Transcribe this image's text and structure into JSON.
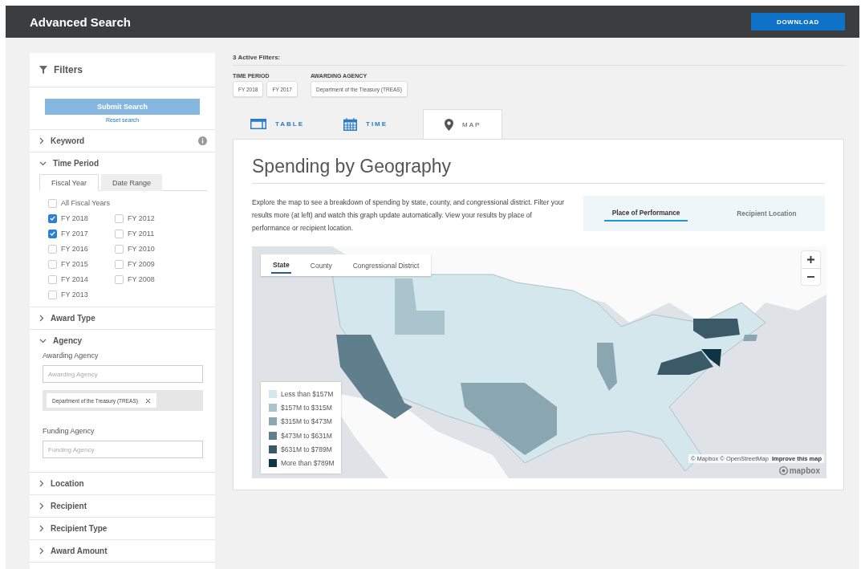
{
  "header": {
    "title": "Advanced Search",
    "download_button": "DOWNLOAD"
  },
  "sidebar": {
    "title": "Filters",
    "submit_button": "Submit Search",
    "reset_link": "Reset search",
    "sections": [
      {
        "label": "Keyword",
        "expanded": false,
        "kind": "keyword"
      },
      {
        "label": "Time Period",
        "expanded": true,
        "kind": "time",
        "tabs": [
          {
            "label": "Fiscal Year",
            "selected": true
          },
          {
            "label": "Date Range",
            "selected": false
          }
        ],
        "all_option": {
          "label": "All Fiscal Years",
          "checked": false
        },
        "years": [
          {
            "label": "FY 2018",
            "checked": true
          },
          {
            "label": "FY 2012",
            "checked": false
          },
          {
            "label": "FY 2017",
            "checked": true
          },
          {
            "label": "FY 2011",
            "checked": false
          },
          {
            "label": "FY 2016",
            "checked": false
          },
          {
            "label": "FY 2010",
            "checked": false
          },
          {
            "label": "FY 2015",
            "checked": false
          },
          {
            "label": "FY 2009",
            "checked": false
          },
          {
            "label": "FY 2014",
            "checked": false
          },
          {
            "label": "FY 2008",
            "checked": false
          },
          {
            "label": "FY 2013",
            "checked": false
          }
        ]
      },
      {
        "label": "Award Type",
        "expanded": false,
        "kind": "plain"
      },
      {
        "label": "Agency",
        "expanded": true,
        "kind": "agency",
        "fields": [
          {
            "label": "Awarding Agency",
            "placeholder": "Awarding Agency",
            "tags": [
              "Department of the Treasury (TREAS)"
            ]
          },
          {
            "label": "Funding Agency",
            "placeholder": "Funding Agency"
          }
        ]
      },
      {
        "label": "Location",
        "expanded": false,
        "kind": "plain"
      },
      {
        "label": "Recipient",
        "expanded": false,
        "kind": "plain"
      },
      {
        "label": "Recipient Type",
        "expanded": false,
        "kind": "plain"
      },
      {
        "label": "Award Amount",
        "expanded": false,
        "kind": "plain"
      }
    ]
  },
  "active_filters": {
    "title": "3 Active Filters:",
    "groups": [
      {
        "label": "TIME PERIOD",
        "chips": [
          "FY 2018",
          "FY 2017"
        ]
      },
      {
        "label": "AWARDING AGENCY",
        "chips": [
          "Department of the Treasury (TREAS)"
        ]
      }
    ]
  },
  "view_tabs": [
    {
      "label": "TABLE",
      "selected": false,
      "kind": "table"
    },
    {
      "label": "TIME",
      "selected": false,
      "kind": "time"
    },
    {
      "label": "MAP",
      "selected": true,
      "kind": "map"
    }
  ],
  "panel": {
    "title": "Spending by Geography",
    "description": "Explore the map to see a breakdown of spending by state, county, and congressional district. Filter your results more (at left) and watch this graph update automatically. View your results by place of performance or recipient location.",
    "location_toggle": [
      {
        "label": "Place of Performance",
        "selected": true
      },
      {
        "label": "Recipient Location",
        "selected": false
      }
    ],
    "map": {
      "scope_tabs": [
        {
          "label": "State",
          "selected": true
        },
        {
          "label": "County",
          "selected": false
        },
        {
          "label": "Congressional District",
          "selected": false
        }
      ],
      "legend": [
        {
          "label": "Less than $157M",
          "color": "#d3e7ed"
        },
        {
          "label": "$157M to $315M",
          "color": "#a9c4cc"
        },
        {
          "label": "$315M to $473M",
          "color": "#8aa7b1"
        },
        {
          "label": "$473M to $631M",
          "color": "#5f7f8c"
        },
        {
          "label": "$631M to $789M",
          "color": "#3b5a68"
        },
        {
          "label": "More than $789M",
          "color": "#0f3445"
        }
      ],
      "attribution": "© Mapbox © OpenStreetMap",
      "improve_link": "Improve this map",
      "logo": "mapbox"
    }
  }
}
